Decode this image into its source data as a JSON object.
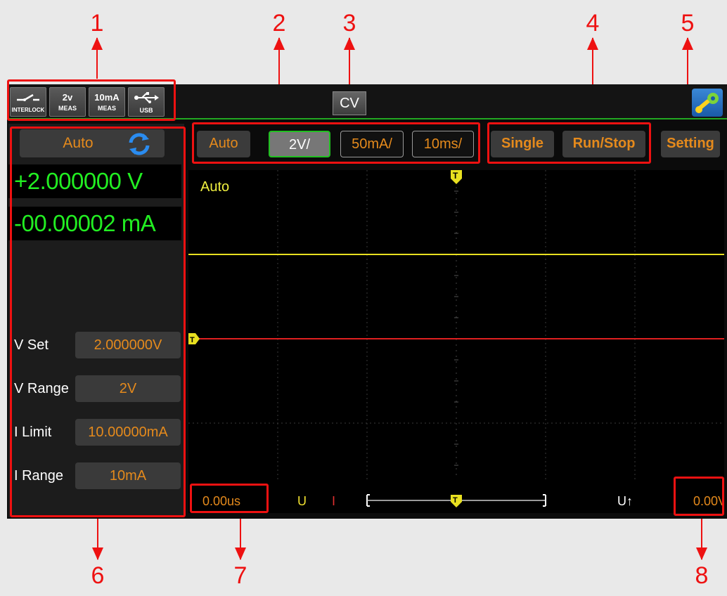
{
  "callouts": [
    "1",
    "2",
    "3",
    "4",
    "5",
    "6",
    "7",
    "8"
  ],
  "status_icons": [
    {
      "big": "",
      "small": "INTERLOCK",
      "icon": "interlock-switch-icon"
    },
    {
      "big": "2v",
      "small": "MEAS",
      "icon": "voltage-meas-icon"
    },
    {
      "big": "10mA",
      "small": "MEAS",
      "icon": "current-meas-icon"
    },
    {
      "big": "",
      "small": "USB",
      "icon": "usb-icon"
    }
  ],
  "mode_badge": "CV",
  "left_panel": {
    "range_mode": "Auto",
    "voltage_reading": "+2.000000 V",
    "current_reading": "-00.00002 mA",
    "params": [
      {
        "label": "V Set",
        "value": "2.000000V"
      },
      {
        "label": "V Range",
        "value": "2V"
      },
      {
        "label": "I Limit",
        "value": "10.00000mA"
      },
      {
        "label": "I Range",
        "value": "10mA"
      }
    ]
  },
  "toolbar": {
    "auto": "Auto",
    "volts_div": "2V/",
    "amps_div": "50mA/",
    "time_div": "10ms/",
    "single": "Single",
    "run_stop": "Run/Stop",
    "setting": "Setting"
  },
  "scope": {
    "mode_label": "Auto",
    "trigger_marker": "T",
    "time_offset": "0.00us",
    "ch_u": "U",
    "ch_i": "I",
    "trigger_source": "U↑",
    "trigger_level": "0.00V"
  },
  "colors": {
    "voltage_trace": "#e8e020",
    "current_trace": "#e02020",
    "accent": "#e58a1c",
    "readout": "#22ee22"
  }
}
